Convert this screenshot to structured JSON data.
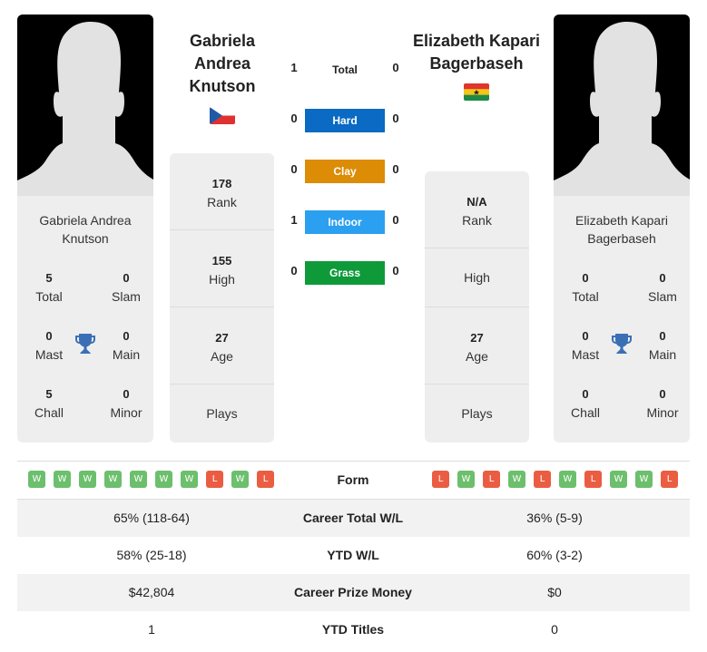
{
  "left_player": {
    "name": "Gabriela Andrea Knutson",
    "name_lines": [
      "Gabriela",
      "Andrea",
      "Knutson"
    ],
    "card_name_lines": [
      "Gabriela Andrea",
      "Knutson"
    ],
    "flag": "czech-republic",
    "titles": {
      "total": {
        "value": "5",
        "label": "Total"
      },
      "slam": {
        "value": "0",
        "label": "Slam"
      },
      "mast": {
        "value": "0",
        "label": "Mast"
      },
      "main": {
        "value": "0",
        "label": "Main"
      },
      "chall": {
        "value": "5",
        "label": "Chall"
      },
      "minor": {
        "value": "0",
        "label": "Minor"
      }
    },
    "info": {
      "rank": {
        "value": "178",
        "label": "Rank"
      },
      "high": {
        "value": "155",
        "label": "High"
      },
      "age": {
        "value": "27",
        "label": "Age"
      },
      "plays": {
        "value": "",
        "label": "Plays"
      }
    },
    "form": [
      "W",
      "W",
      "W",
      "W",
      "W",
      "W",
      "W",
      "L",
      "W",
      "L"
    ]
  },
  "right_player": {
    "name": "Elizabeth Kapari Bagerbaseh",
    "name_lines": [
      "Elizabeth Kapari",
      "Bagerbaseh"
    ],
    "card_name_lines": [
      "Elizabeth Kapari",
      "Bagerbaseh"
    ],
    "flag": "ghana",
    "titles": {
      "total": {
        "value": "0",
        "label": "Total"
      },
      "slam": {
        "value": "0",
        "label": "Slam"
      },
      "mast": {
        "value": "0",
        "label": "Mast"
      },
      "main": {
        "value": "0",
        "label": "Main"
      },
      "chall": {
        "value": "0",
        "label": "Chall"
      },
      "minor": {
        "value": "0",
        "label": "Minor"
      }
    },
    "info": {
      "rank": {
        "value": "N/A",
        "label": "Rank"
      },
      "high": {
        "value": "",
        "label": "High"
      },
      "age": {
        "value": "27",
        "label": "Age"
      },
      "plays": {
        "value": "",
        "label": "Plays"
      }
    },
    "form": [
      "L",
      "W",
      "L",
      "W",
      "L",
      "W",
      "L",
      "W",
      "W",
      "L"
    ]
  },
  "h2h": [
    {
      "label": "Total",
      "left": "1",
      "right": "0",
      "color": ""
    },
    {
      "label": "Hard",
      "left": "0",
      "right": "0",
      "color": "#0a6ac4"
    },
    {
      "label": "Clay",
      "left": "0",
      "right": "0",
      "color": "#dc8c05"
    },
    {
      "label": "Indoor",
      "left": "1",
      "right": "0",
      "color": "#2b9ff0"
    },
    {
      "label": "Grass",
      "left": "0",
      "right": "0",
      "color": "#0f9a3a"
    }
  ],
  "form_label": "Form",
  "comparison": [
    {
      "label": "Career Total W/L",
      "left": "65% (118-64)",
      "right": "36% (5-9)"
    },
    {
      "label": "YTD W/L",
      "left": "58% (25-18)",
      "right": "60% (3-2)"
    },
    {
      "label": "Career Prize Money",
      "left": "$42,804",
      "right": "$0"
    },
    {
      "label": "YTD Titles",
      "left": "1",
      "right": "0"
    }
  ],
  "colors": {
    "win": "#6cbf6c",
    "loss": "#ea5d42",
    "trophy": "#3a6fb6"
  }
}
